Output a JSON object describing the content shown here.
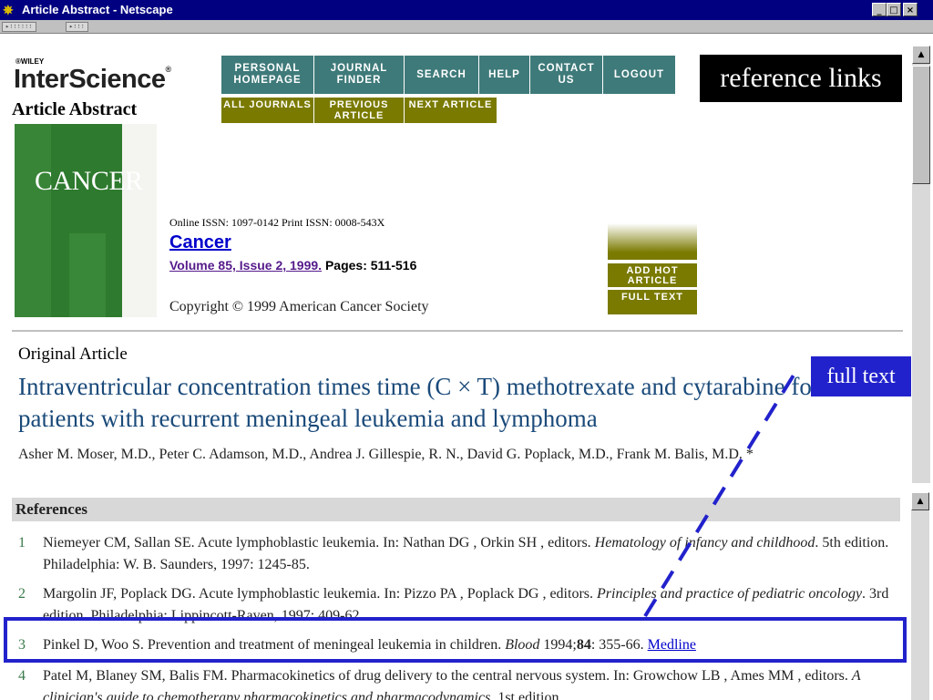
{
  "window": {
    "title": "Article Abstract - Netscape",
    "minimize": "_",
    "restore": "□",
    "close": "×"
  },
  "toolstrip": {
    "grip1": "▸∶∶∶∶∶∶",
    "grip2": "▸∶∶∶"
  },
  "logo": {
    "publisher": "®WILEY",
    "name": "InterScience",
    "reg": "®"
  },
  "page_heading": "Article Abstract",
  "nav_top": [
    {
      "label": "PERSONAL HOMEPAGE"
    },
    {
      "label": "JOURNAL FINDER"
    },
    {
      "label": "SEARCH"
    },
    {
      "label": "HELP"
    },
    {
      "label": "CONTACT US"
    },
    {
      "label": "LOGOUT"
    }
  ],
  "nav_bottom": [
    {
      "label": "ALL JOURNALS"
    },
    {
      "label": "PREVIOUS ARTICLE"
    },
    {
      "label": "NEXT ARTICLE"
    }
  ],
  "callouts": {
    "reference_links": "reference links",
    "full_text": "full text"
  },
  "cover": {
    "title": "CANCER"
  },
  "journal": {
    "issn": "Online ISSN: 1097-0142   Print ISSN: 0008-543X",
    "name": "Cancer",
    "volume": "Volume 85, Issue 2, 1999.",
    "pages": " Pages: 511-516",
    "copyright": "Copyright © 1999 American Cancer Society"
  },
  "side_buttons": {
    "add_hot": "ADD HOT ARTICLE",
    "full_text": "FULL TEXT"
  },
  "article": {
    "section": "Original Article",
    "title": "Intraventricular concentration times time (C × T) methotrexate and cytarabine for patients with recurrent meningeal leukemia and lymphoma",
    "authors": "Asher M. Moser, M.D., Peter C. Adamson, M.D., Andrea J. Gillespie, R. N., David G. Poplack, M.D., Frank M. Balis, M.D. *"
  },
  "references": {
    "heading": "References",
    "items": [
      {
        "num": "1",
        "text": "Niemeyer CM, Sallan SE. Acute lymphoblastic leukemia. In: Nathan DG , Orkin SH , editors. ",
        "italic": "Hematology of infancy and childhood",
        "tail": ". 5th edition. Philadelphia: W. B. Saunders, 1997: 1245-85."
      },
      {
        "num": "2",
        "text": "Margolin JF, Poplack DG. Acute lymphoblastic leukemia. In: Pizzo PA , Poplack DG , editors. ",
        "italic": "Principles and practice of pediatric oncology",
        "tail": ". 3rd edition. Philadelphia: Lippincott-Raven, 1997: 409-62."
      },
      {
        "num": "3",
        "text": "Pinkel D, Woo S. Prevention and treatment of meningeal leukemia in children. ",
        "italic": "Blood",
        "year": " 1994;",
        "vol": "84",
        "tail": ": 355-66. ",
        "link": "Medline"
      },
      {
        "num": "4",
        "text": "Patel M, Blaney SM, Balis FM. Pharmacokinetics of drug delivery to the central nervous system. In: Growchow LB , Ames MM , editors. ",
        "italic": "A clinician's guide to chemotherapy pharmacokinetics and pharmacodynamics",
        "tail": ". 1st edition."
      }
    ]
  },
  "colors": {
    "titlebar": "#000080",
    "nav_teal": "#3f7a7a",
    "nav_olive": "#7a7a00",
    "callout_blue": "#2222cc",
    "title_blue": "#1a4a7a"
  }
}
